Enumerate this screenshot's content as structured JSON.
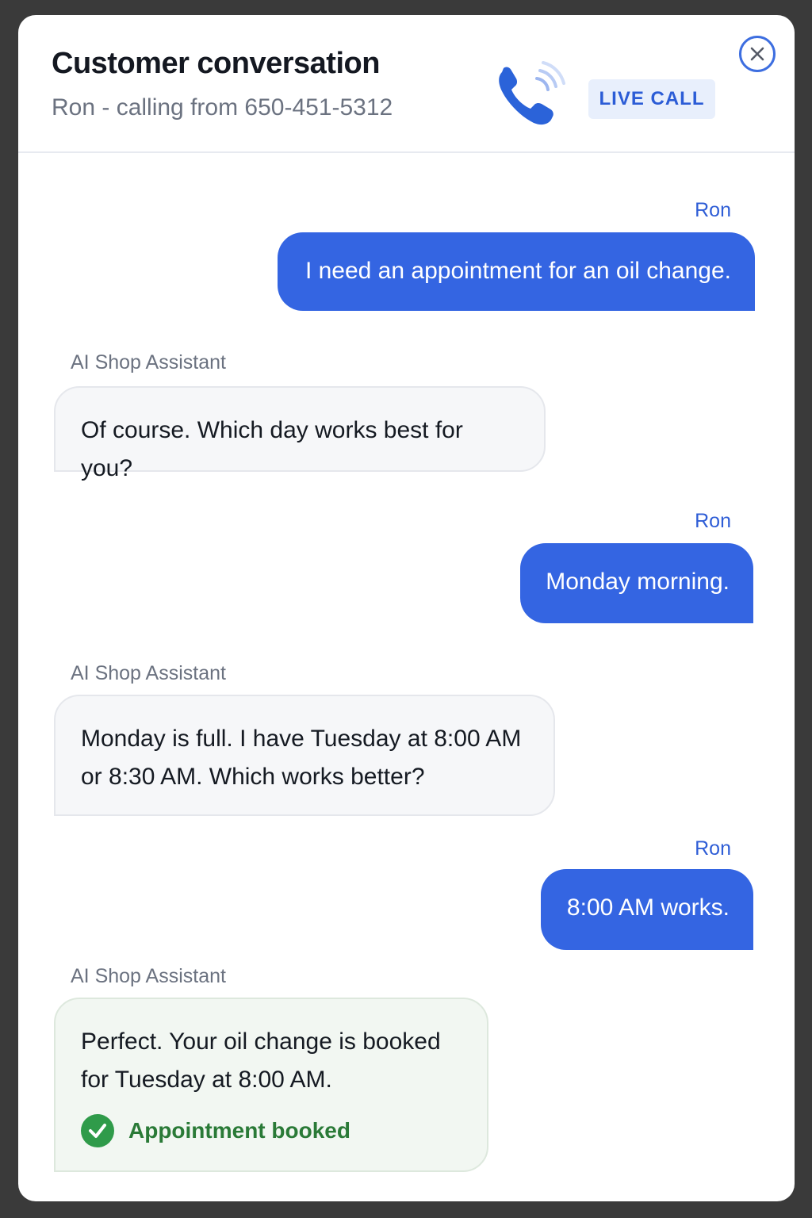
{
  "header": {
    "title": "Customer conversation",
    "subtitle": "Ron - calling from 650-451-5312",
    "badge": "LIVE CALL",
    "icons": {
      "phone": "phone-ringing-icon",
      "close": "close-icon"
    }
  },
  "messages": [
    {
      "sender": "Ron",
      "role": "user",
      "text": "I need an appointment for an oil change."
    },
    {
      "sender": "AI Shop Assistant",
      "role": "ai",
      "text": "Of course. Which day works best for you?"
    },
    {
      "sender": "Ron",
      "role": "user",
      "text": "Monday morning."
    },
    {
      "sender": "AI Shop Assistant",
      "role": "ai",
      "text": "Monday is full. I have Tuesday at 8:00 AM or 8:30 AM. Which works better?"
    },
    {
      "sender": "Ron",
      "role": "user",
      "text": "8:00 AM works."
    },
    {
      "sender": "AI Shop Assistant",
      "role": "ai",
      "text": "Perfect. Your oil change is booked for Tuesday at 8:00 AM.",
      "status": "Appointment booked"
    }
  ],
  "colors": {
    "user_bubble": "#3465e2",
    "accent": "#2b5cd6",
    "success": "#2f9b4a"
  }
}
